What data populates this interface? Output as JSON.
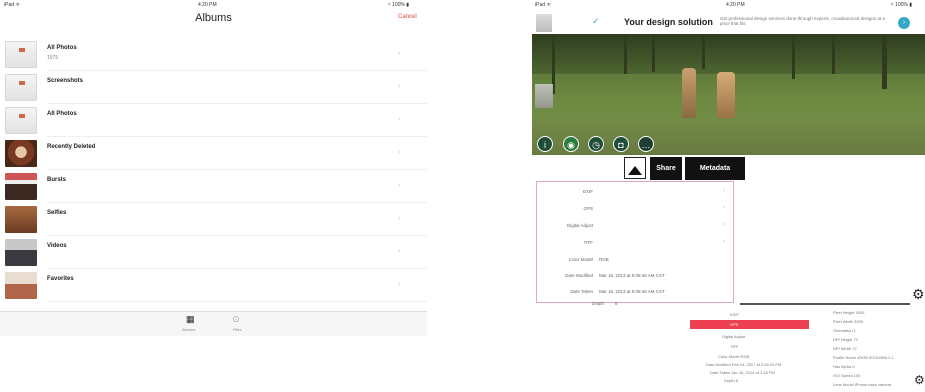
{
  "albums_screen": {
    "status_left": "iPad ᯤ",
    "status_time": "4:20 PM",
    "status_right": "≈ 100% ▮",
    "title": "Albums",
    "cancel": "Cancel",
    "rows": [
      {
        "label": "All Photos",
        "count": "1975"
      },
      {
        "label": "Screenshots",
        "count": ""
      },
      {
        "label": "All Photos",
        "count": ""
      },
      {
        "label": "Recently Deleted",
        "count": ""
      },
      {
        "label": "Bursts",
        "count": ""
      },
      {
        "label": "Selfies",
        "count": ""
      },
      {
        "label": "Videos",
        "count": ""
      },
      {
        "label": "Favorites",
        "count": ""
      }
    ],
    "tabs": [
      {
        "label": "Albums"
      },
      {
        "label": "Files"
      }
    ]
  },
  "app_screen": {
    "status_left": "iPad ᯤ",
    "status_time": "4:20 PM",
    "status_right": "≈ 100% ▮",
    "ad_title": "Your design solution",
    "ad_subtitle": "Get professional design services done through experts, crowdsourced designs at a price that fits",
    "buttons": {
      "share": "Share",
      "metadata": "Metadata"
    },
    "meta_rows": [
      {
        "key": "EXIF",
        "value": "",
        "chev": "›"
      },
      {
        "key": "GPS",
        "value": "",
        "chev": "›"
      },
      {
        "key": "Digital Adjust",
        "value": "",
        "chev": "›"
      },
      {
        "key": "TIFF",
        "value": "",
        "chev": "›"
      },
      {
        "key": "Color Model",
        "value": "RGB",
        "chev": ""
      },
      {
        "key": "Date Modified",
        "value": "Mar 16, 2013 at 6:08:48 AM CST",
        "chev": ""
      },
      {
        "key": "Date Taken",
        "value": "Mar 16, 2013 at 6:08:48 AM CST",
        "chev": ""
      },
      {
        "key": "Depth",
        "value": "8",
        "chev": ""
      }
    ],
    "bottom_left": [
      {
        "text": "EXIF"
      },
      {
        "text": "GPS"
      },
      {
        "text": "Digital Adjust"
      },
      {
        "text": "TIFF"
      },
      {
        "text": "Color Model  RGB"
      },
      {
        "text": "Date Modified  Feb 24, 2017 at 2:26:10 PM"
      },
      {
        "text": "Date Taken  Jan 16, 2014 at 1:18 PM"
      },
      {
        "text": "Depth  8"
      }
    ],
    "bottom_right": [
      {
        "text": "Pixel Height  3000"
      },
      {
        "text": "Pixel Width  3000"
      },
      {
        "text": "Orientation  1"
      },
      {
        "text": "DPI Height  72"
      },
      {
        "text": "DPI Width  72"
      },
      {
        "text": "Profile Name  sRGB IEC61966-2.1"
      },
      {
        "text": "Has Alpha  0"
      },
      {
        "text": "ISO Speed  100"
      },
      {
        "text": "Lens Model  iPhone back camera"
      }
    ]
  },
  "colors": {
    "accent_red": "#ec3f52",
    "cancel_red": "#e0473f",
    "ad_info": "#35a8c8"
  }
}
